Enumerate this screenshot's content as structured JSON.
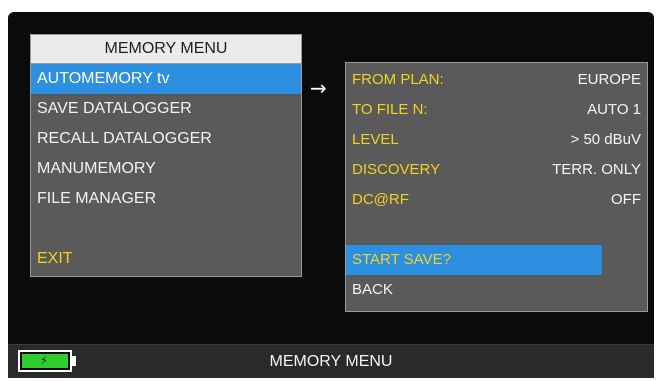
{
  "menu": {
    "title": "MEMORY MENU",
    "items": [
      {
        "label": "AUTOMEMORY tv",
        "selected": true
      },
      {
        "label": "SAVE DATALOGGER",
        "selected": false
      },
      {
        "label": "RECALL DATALOGGER",
        "selected": false
      },
      {
        "label": "MANUMEMORY",
        "selected": false
      },
      {
        "label": "FILE MANAGER",
        "selected": false
      }
    ],
    "exit_label": "EXIT"
  },
  "arrow_icon": "arrow-right-icon",
  "panel": {
    "params": [
      {
        "label": "FROM PLAN:",
        "value": "EUROPE"
      },
      {
        "label": "TO FILE N:",
        "value": "AUTO 1"
      },
      {
        "label": "LEVEL",
        "value": "> 50 dBuV"
      },
      {
        "label": "DISCOVERY",
        "value": "TERR. ONLY"
      },
      {
        "label": "DC@RF",
        "value": "OFF"
      }
    ],
    "start_label": "START SAVE?",
    "back_label": "BACK"
  },
  "statusbar": {
    "title": "MEMORY MENU",
    "battery_icon": "battery-charging-icon"
  },
  "colors": {
    "highlight": "#2c8fe0",
    "label_yellow": "#f2d21e",
    "panel_gray": "#5a5a5a",
    "battery_green": "#2ecc2e"
  }
}
